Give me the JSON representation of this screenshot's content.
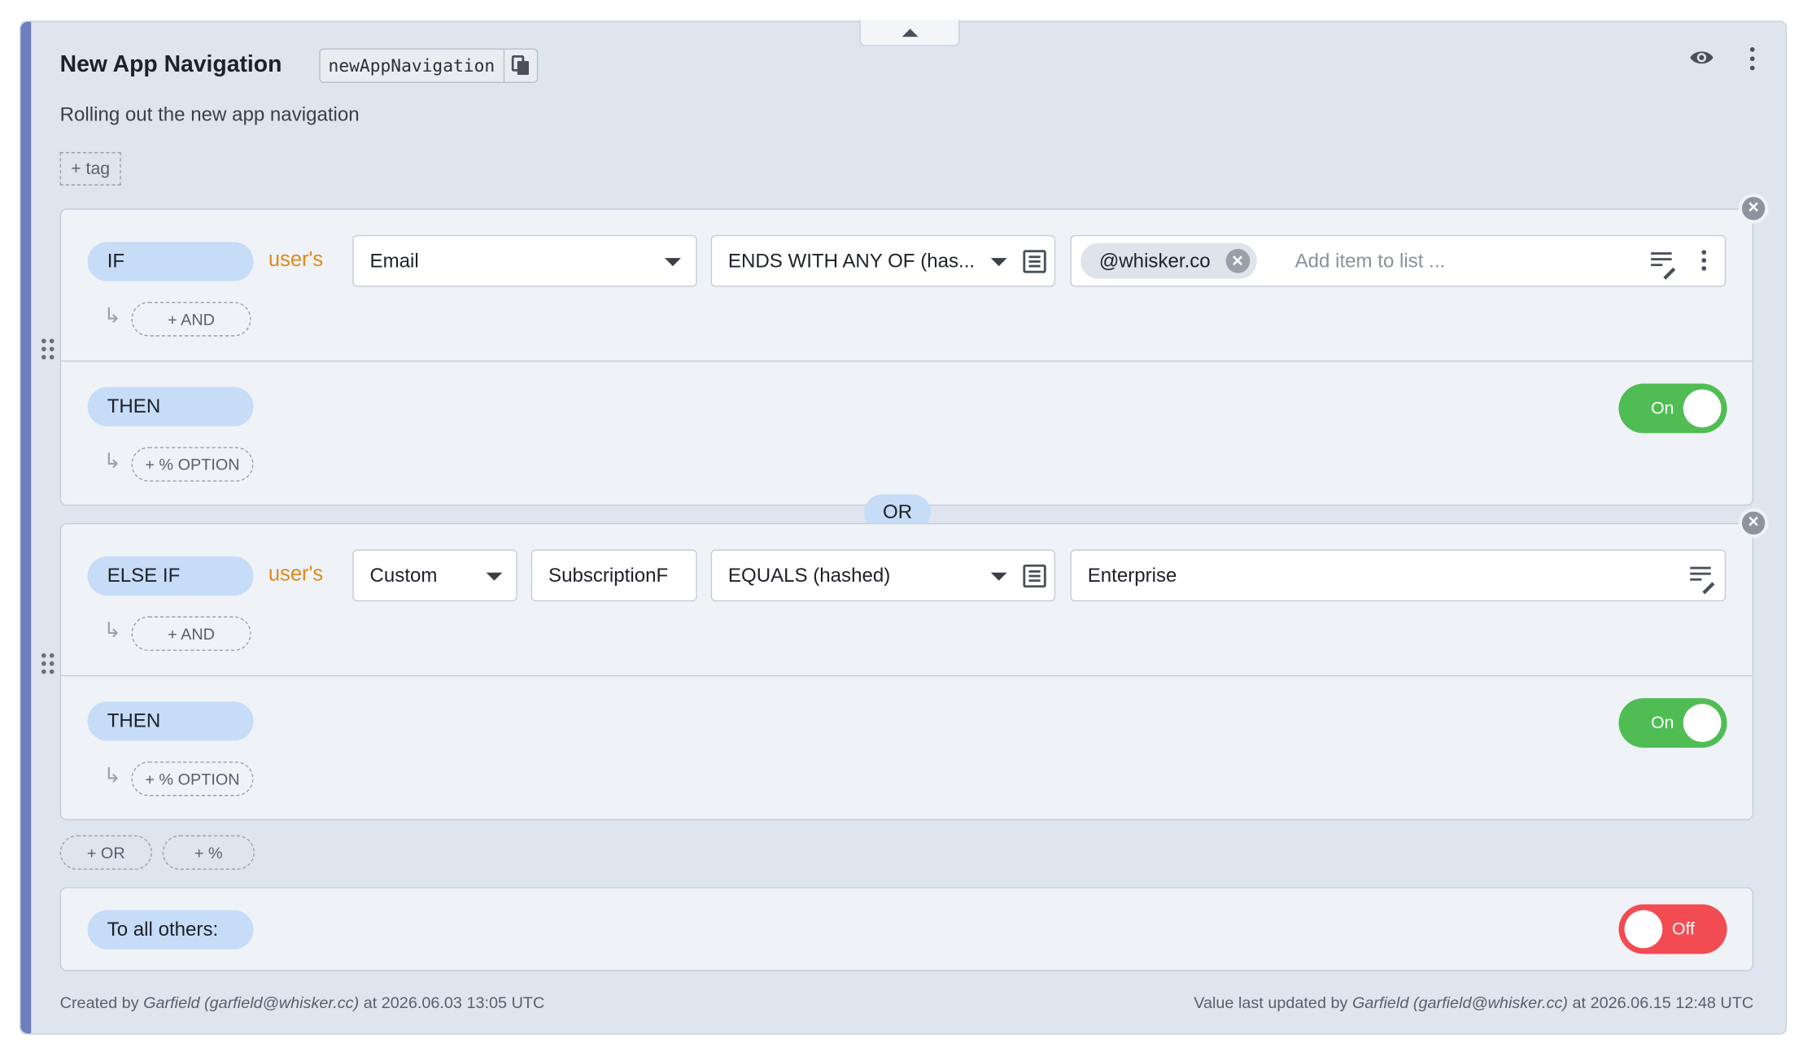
{
  "flag": {
    "title": "New App Navigation",
    "key": "newAppNavigation",
    "description": "Rolling out the new app navigation",
    "tag_button": "+ tag"
  },
  "rules": [
    {
      "keyword": "IF",
      "subject": "user's",
      "attribute": "Email",
      "operator": "ENDS WITH ANY OF (has...",
      "value_chip": "@whisker.co",
      "value_placeholder": "Add item to list ...",
      "add_and": "+ AND",
      "then": "THEN",
      "add_option": "+ % OPTION",
      "toggle": "On"
    },
    {
      "keyword": "ELSE IF",
      "subject": "user's",
      "attribute": "Custom",
      "custom_attribute": "SubscriptionF",
      "operator": "EQUALS (hashed)",
      "value": "Enterprise",
      "add_and": "+ AND",
      "then": "THEN",
      "add_option": "+ % OPTION",
      "toggle": "On"
    }
  ],
  "or_label": "OR",
  "add_or": "+ OR",
  "add_percent": "+ %",
  "default_rule": {
    "label": "To all others:",
    "toggle": "Off"
  },
  "footer": {
    "created_prefix": "Created by ",
    "created_user": "Garfield (garfield@whisker.cc)",
    "created_suffix": " at 2026.06.03 13:05 UTC",
    "updated_prefix": "Value last updated by ",
    "updated_user": "Garfield (garfield@whisker.cc)",
    "updated_suffix": " at 2026.06.15 12:48 UTC"
  },
  "colors": {
    "accent": "#6d7dbd",
    "pill": "#c6dcf7",
    "on": "#4fbd53",
    "off": "#f24b52",
    "subject": "#e08a1a"
  }
}
